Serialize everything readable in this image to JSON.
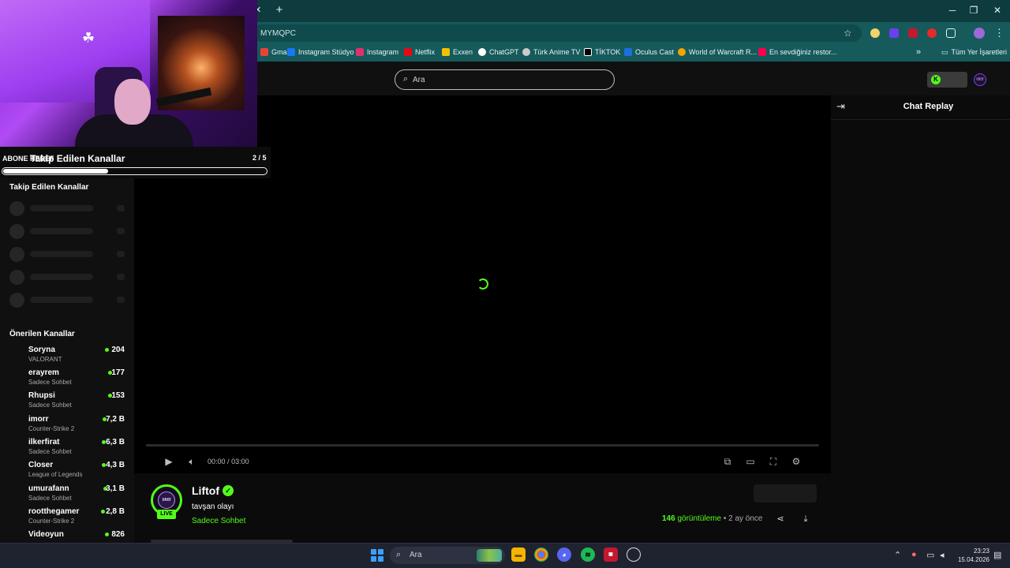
{
  "browser": {
    "new_tab": "+",
    "tab_close": "✕",
    "url_fragment": "MYMQPC",
    "window_controls": [
      "─",
      "❐",
      "✕"
    ],
    "bookmarks": [
      {
        "label": "Gmail",
        "color": "#ea4335"
      },
      {
        "label": "Instagram Stüdyo",
        "color": "#1877f2"
      },
      {
        "label": "Instagram",
        "color": "#e1306c"
      },
      {
        "label": "Netflix",
        "color": "#e50914"
      },
      {
        "label": "Exxen",
        "color": "#f2c200"
      },
      {
        "label": "ChatGPT",
        "color": "#ffffff"
      },
      {
        "label": "Türk Anime TV",
        "color": "#cccccc"
      },
      {
        "label": "TİKTOK",
        "color": "#000000"
      },
      {
        "label": "Oculus Cast",
        "color": "#1c6fe0"
      },
      {
        "label": "World of Warcraft R...",
        "color": "#f4a300"
      },
      {
        "label": "En sevdiğiniz restor...",
        "color": "#fa0050"
      }
    ],
    "bookmarks_more": "»",
    "all_bookmarks": "Tüm Yer İşaretleri"
  },
  "header": {
    "search_placeholder": "Ara"
  },
  "goal": {
    "label": "ABONE HEDEF",
    "title": "Takip Edilen Kanallar",
    "count": "2 / 5",
    "progress": 0.4
  },
  "sidebar": {
    "followed_title": "Takip Edilen Kanallar",
    "recommended_title": "Önerilen Kanallar",
    "recommended": [
      {
        "name": "Soryna",
        "category": "VALORANT",
        "viewers": "204"
      },
      {
        "name": "erayrem",
        "category": "Sadece Sohbet",
        "viewers": "177"
      },
      {
        "name": "Rhupsi",
        "category": "Sadece Sohbet",
        "viewers": "153"
      },
      {
        "name": "imorr",
        "category": "Counter-Strike 2",
        "viewers": "7,2 B"
      },
      {
        "name": "ilkerfirat",
        "category": "Sadece Sohbet",
        "viewers": "6,3 B"
      },
      {
        "name": "Closer",
        "category": "League of Legends",
        "viewers": "4,3 B"
      },
      {
        "name": "umurafann",
        "category": "Sadece Sohbet",
        "viewers": "3,1 B"
      },
      {
        "name": "rootthegamer",
        "category": "Counter-Strike 2",
        "viewers": "2,8 B"
      },
      {
        "name": "Videoyun",
        "category": "",
        "viewers": "826"
      }
    ]
  },
  "player": {
    "time_current": "00:00",
    "time_total": "03:00",
    "time_separator": "/"
  },
  "chat": {
    "title": "Chat Replay"
  },
  "channel": {
    "name": "Liftof",
    "avatar_text": "lift0f",
    "live_badge": "LIVE",
    "video_title": "tavşan olayı",
    "category": "Sadece Sohbet",
    "views_count": "146",
    "views_label": "görüntüleme",
    "age": "• 2 ay önce"
  },
  "taskbar": {
    "search_placeholder": "Ara",
    "time": "23:23",
    "date": "15.04.2026"
  }
}
